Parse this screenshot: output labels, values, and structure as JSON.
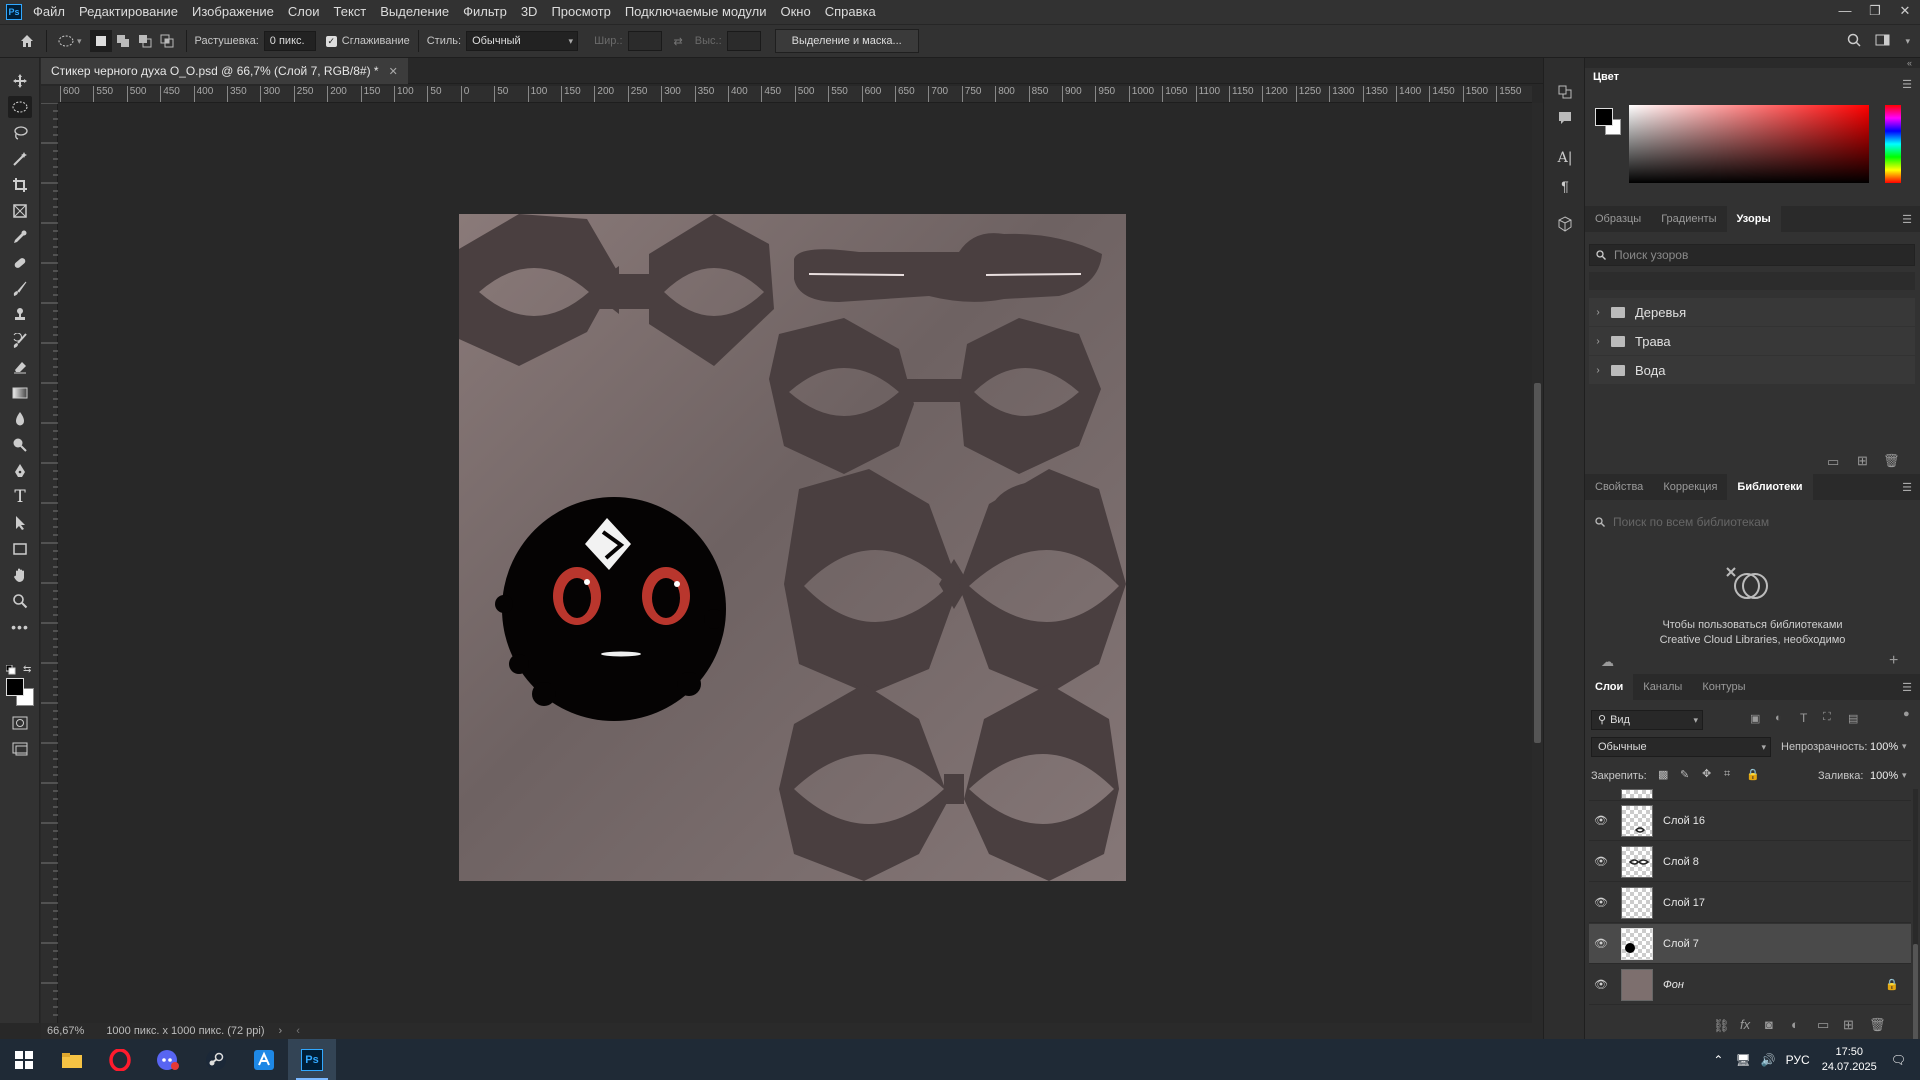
{
  "menubar": {
    "items": [
      "Файл",
      "Редактирование",
      "Изображение",
      "Слои",
      "Текст",
      "Выделение",
      "Фильтр",
      "3D",
      "Просмотр",
      "Подключаемые модули",
      "Окно",
      "Справка"
    ]
  },
  "options": {
    "feather_label": "Растушевка:",
    "feather_value": "0 пикс.",
    "antialias_label": "Сглаживание",
    "style_label": "Стиль:",
    "style_value": "Обычный",
    "width_label": "Шир.:",
    "height_label": "Выс.:",
    "mask_button": "Выделение и маска..."
  },
  "document": {
    "tab_title": "Стикер черного духа O_O.psd @ 66,7% (Слой 7, RGB/8#) *",
    "zoom": "66,67%",
    "doc_info": "1000 пикс. x 1000 пикс. (72 ppi)"
  },
  "ruler": {
    "h_ticks": [
      "600",
      "550",
      "500",
      "450",
      "400",
      "350",
      "300",
      "250",
      "200",
      "150",
      "100",
      "50",
      "0",
      "50",
      "100",
      "150",
      "200",
      "250",
      "300",
      "350",
      "400",
      "450",
      "500",
      "550",
      "600",
      "650",
      "700",
      "750",
      "800",
      "850",
      "900",
      "950",
      "1000",
      "1050",
      "1100",
      "1150",
      "1200",
      "1250",
      "1300",
      "1350",
      "1400",
      "1450",
      "1500",
      "1550"
    ]
  },
  "color_panel": {
    "title": "Цвет",
    "foreground": "#000000",
    "background": "#ffffff"
  },
  "patterns_panel": {
    "tabs": [
      "Образцы",
      "Градиенты",
      "Узоры"
    ],
    "active_tab": "Узоры",
    "search_placeholder": "Поиск узоров",
    "folders": [
      "Деревья",
      "Трава",
      "Вода"
    ]
  },
  "libraries_panel": {
    "tabs": [
      "Свойства",
      "Коррекция",
      "Библиотеки"
    ],
    "active_tab": "Библиотеки",
    "search_placeholder": "Поиск по всем библиотекам",
    "message_line1": "Чтобы пользоваться библиотеками",
    "message_line2": "Creative Cloud Libraries, необходимо"
  },
  "layers_panel": {
    "tabs": [
      "Слои",
      "Каналы",
      "Контуры"
    ],
    "active_tab": "Слои",
    "filter_kind": "Вид",
    "blend_mode": "Обычные",
    "opacity_label": "Непрозрачность:",
    "opacity_value": "100%",
    "lock_label": "Закрепить:",
    "fill_label": "Заливка:",
    "fill_value": "100%",
    "layers": [
      {
        "name": "Слой 16",
        "selected": false
      },
      {
        "name": "Слой 8",
        "selected": false
      },
      {
        "name": "Слой 17",
        "selected": false
      },
      {
        "name": "Слой 7",
        "selected": true
      },
      {
        "name": "Фон",
        "selected": false,
        "locked": true
      }
    ]
  },
  "taskbar": {
    "lang": "РУС",
    "time": "17:50",
    "date": "24.07.2025"
  }
}
